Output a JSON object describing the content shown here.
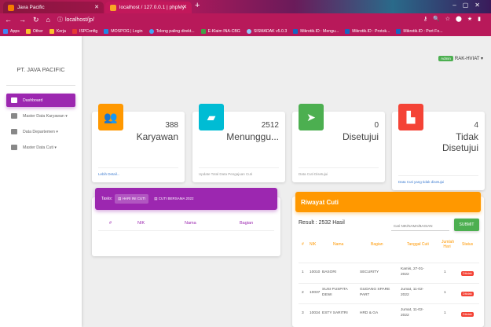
{
  "browser": {
    "tabs": [
      {
        "title": "Java Pacific",
        "icon": "java-favicon"
      },
      {
        "title": "localhost / 127.0.0.1 | phpMyAdm",
        "icon": "phpmyadmin-favicon"
      }
    ],
    "url": "localhost/jp/",
    "bookmarks": [
      "Apps",
      "Other",
      "Kerja",
      "ISPConfig",
      "MOSPOG | Login",
      "Tolong paling direkt...",
      "E-Klaim INA-CBG",
      "SISMADAK v5.0.3",
      "Mikrotik.ID : Mengu...",
      "Mikrotik.ID : Protok...",
      "Mikrotik.ID : Port Fo..."
    ]
  },
  "sidebar": {
    "brand": "PT. JAVA PACIFIC",
    "items": [
      {
        "label": "Dashboard",
        "active": true
      },
      {
        "label": "Master Data Karyawan ▾",
        "active": false
      },
      {
        "label": "Data Departemen ▾",
        "active": false
      },
      {
        "label": "Master Data Cuti ▾",
        "active": false
      }
    ]
  },
  "user": {
    "badge": "Admin",
    "name": "RAK-HVIAT ▾"
  },
  "cards": [
    {
      "value": "388",
      "label": "Karyawan",
      "footer": "Lebih Detail...",
      "color": "#ff9800"
    },
    {
      "value": "2512",
      "label": "Menunggu...",
      "footer": "Update Total Data Pengajuan Cuti",
      "color": "#00bcd4"
    },
    {
      "value": "0",
      "label": "Disetujui",
      "footer": "Data Cuti Disetujui",
      "color": "#4caf50"
    },
    {
      "value": "4",
      "label": "Tidak Disetujui",
      "footer": "Data Cuti yang tidak disetujui",
      "color": "#f44336"
    }
  ],
  "panel": {
    "tasks_label": "Tasks:",
    "tabs": [
      "HARI INI CUTI",
      "CUTI BERSAMA 2022"
    ],
    "columns": [
      "#",
      "NIK",
      "Nama",
      "Bagian"
    ]
  },
  "riwayat": {
    "title": "Riwayat Cuti",
    "result": "Result : 2532 Hasil",
    "search_placeholder": "Cari NIK/NAMA/BAGIAN",
    "submit": "SUBMIT",
    "columns": [
      "#",
      "NIK",
      "Nama",
      "Bagian",
      "Tanggal Cuti",
      "Jumlah Hari",
      "Status"
    ],
    "rows": [
      {
        "no": "1",
        "nik": "10010",
        "nama": "BASORI",
        "bagian": "SECURITY",
        "tanggal": "Kamis, 27-01-2022",
        "jumlah": "1",
        "status": "Ditolak"
      },
      {
        "no": "2",
        "nik": "10037",
        "nama": "SUSI PUSPITA DEWI",
        "bagian": "GUDANG SPARE PART",
        "tanggal": "Jumat, 11-02-2022",
        "jumlah": "1",
        "status": "Ditolak"
      },
      {
        "no": "3",
        "nik": "10034",
        "nama": "ESTY SARITRI",
        "bagian": "HRD & GA",
        "tanggal": "Jumat, 11-02-2022",
        "jumlah": "1",
        "status": "Ditolak"
      }
    ]
  }
}
